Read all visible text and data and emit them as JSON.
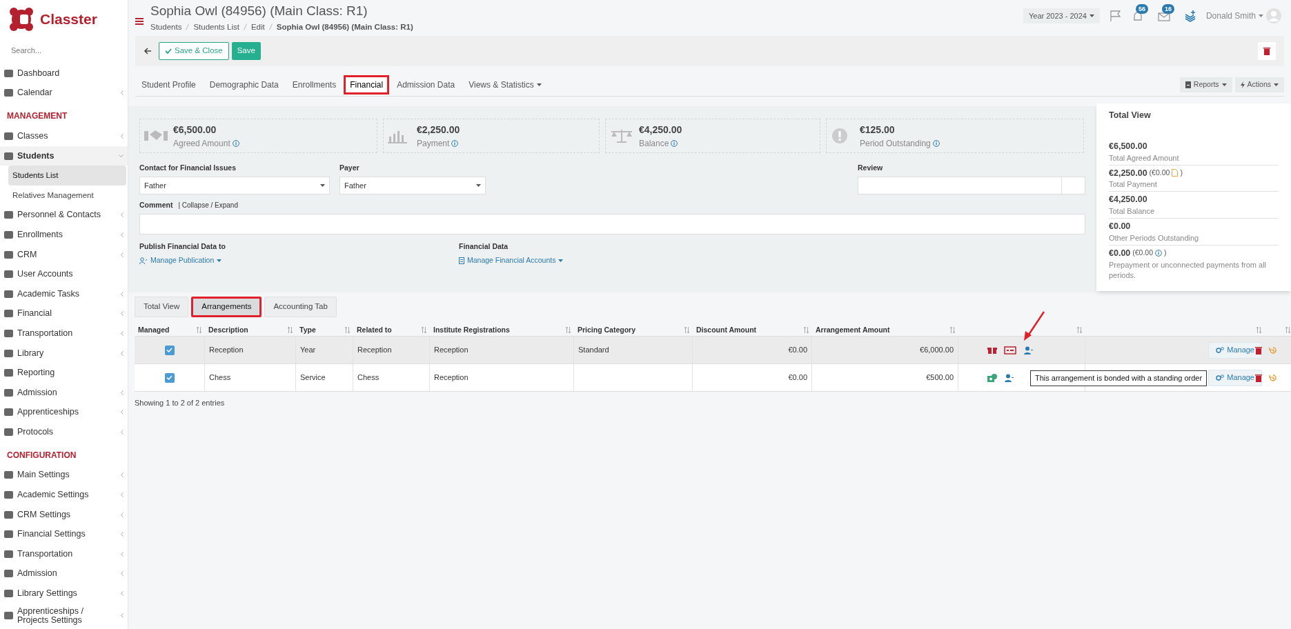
{
  "brand": {
    "name": "Classter"
  },
  "sidebar": {
    "search_placeholder": "Search...",
    "sections": [
      {
        "items": [
          {
            "label": "Dashboard",
            "submenu": false
          },
          {
            "label": "Calendar",
            "submenu": true,
            "expanded": false
          }
        ]
      },
      {
        "heading": "MANAGEMENT",
        "items": [
          {
            "label": "Classes",
            "submenu": true,
            "expanded": false
          },
          {
            "label": "Students",
            "submenu": true,
            "expanded": true,
            "children": [
              {
                "label": "Students List",
                "selected": true
              },
              {
                "label": "Relatives Management",
                "selected": false
              }
            ]
          },
          {
            "label": "Personnel & Contacts",
            "submenu": true,
            "expanded": false
          },
          {
            "label": "Enrollments",
            "submenu": true,
            "expanded": false
          },
          {
            "label": "CRM",
            "submenu": true,
            "expanded": false
          },
          {
            "label": "User Accounts",
            "submenu": false
          },
          {
            "label": "Academic Tasks",
            "submenu": true,
            "expanded": false
          },
          {
            "label": "Financial",
            "submenu": true,
            "expanded": false
          },
          {
            "label": "Transportation",
            "submenu": true,
            "expanded": false
          },
          {
            "label": "Library",
            "submenu": true,
            "expanded": false
          },
          {
            "label": "Reporting",
            "submenu": false
          },
          {
            "label": "Admission",
            "submenu": true,
            "expanded": false
          },
          {
            "label": "Apprenticeships",
            "submenu": true,
            "expanded": false
          },
          {
            "label": "Protocols",
            "submenu": true,
            "expanded": false
          }
        ]
      },
      {
        "heading": "CONFIGURATION",
        "items": [
          {
            "label": "Main Settings",
            "submenu": true,
            "expanded": false
          },
          {
            "label": "Academic Settings",
            "submenu": true,
            "expanded": false
          },
          {
            "label": "CRM Settings",
            "submenu": true,
            "expanded": false
          },
          {
            "label": "Financial Settings",
            "submenu": true,
            "expanded": false
          },
          {
            "label": "Transportation",
            "submenu": true,
            "expanded": false
          },
          {
            "label": "Admission",
            "submenu": true,
            "expanded": false
          },
          {
            "label": "Library Settings",
            "submenu": true,
            "expanded": false
          },
          {
            "label": "Apprenticeships / Projects Settings",
            "submenu": true,
            "expanded": false
          }
        ]
      }
    ]
  },
  "header": {
    "title": "Sophia Owl (84956) (Main Class: R1)",
    "breadcrumbs": [
      "Students",
      "Students List",
      "Edit",
      "Sophia Owl (84956) (Main Class: R1)"
    ],
    "year": "Year 2023 - 2024",
    "notifications": "56",
    "messages": "16",
    "user": "Donald Smith"
  },
  "toolbar": {
    "save_close": "Save & Close",
    "save": "Save"
  },
  "tabs": [
    {
      "label": "Student Profile",
      "selected": false,
      "highlighted": false
    },
    {
      "label": "Demographic Data",
      "selected": false,
      "highlighted": false
    },
    {
      "label": "Enrollments",
      "selected": false,
      "highlighted": false
    },
    {
      "label": "Financial",
      "selected": true,
      "highlighted": true
    },
    {
      "label": "Admission Data",
      "selected": false,
      "highlighted": false
    },
    {
      "label": "Views & Statistics",
      "selected": false,
      "highlighted": false,
      "dropdown": true
    }
  ],
  "tab_actions": [
    "Reports",
    "Actions"
  ],
  "stats": [
    {
      "amount": "€6,500.00",
      "label": "Agreed Amount"
    },
    {
      "amount": "€2,250.00",
      "label": "Payment"
    },
    {
      "amount": "€4,250.00",
      "label": "Balance"
    },
    {
      "amount": "€125.00",
      "label": "Period Outstanding"
    }
  ],
  "form": {
    "contact_label": "Contact for Financial Issues",
    "contact_value": "Father",
    "payer_label": "Payer",
    "payer_value": "Father",
    "review_label": "Review",
    "comment_label": "Comment",
    "comment_toggle": "| Collapse / Expand",
    "publish_label": "Publish Financial Data to",
    "publish_link": "Manage Publication",
    "financial_label": "Financial Data",
    "financial_link": "Manage Financial Accounts"
  },
  "total_view": {
    "title": "Total View",
    "entries": [
      {
        "amount": "€6,500.00",
        "label": "Total Agreed Amount"
      },
      {
        "amount": "€2,250.00",
        "note": {
          "kind": "document",
          "text": "(€0.00",
          "closing": ")"
        },
        "label": "Total Payment"
      },
      {
        "amount": "€4,250.00",
        "label": "Total Balance"
      },
      {
        "amount": "€0.00",
        "label": "Other Periods Outstanding"
      },
      {
        "amount": "€0.00",
        "note": {
          "kind": "info",
          "text": "(€0.00",
          "closing": ")"
        },
        "label": "Prepayment or unconnected payments from all periods."
      }
    ]
  },
  "sub_tabs": [
    {
      "label": "Total View",
      "selected": false,
      "highlighted": false
    },
    {
      "label": "Arrangements",
      "selected": true,
      "highlighted": true
    },
    {
      "label": "Accounting Tab",
      "selected": false,
      "highlighted": false
    }
  ],
  "table": {
    "columns": [
      "Managed",
      "Description",
      "Type",
      "Related to",
      "Institute Registrations",
      "Pricing Category",
      "Discount Amount",
      "Arrangement Amount"
    ],
    "rows": [
      {
        "managed": true,
        "selected": true,
        "description": "Reception",
        "type": "Year",
        "related_to": "Reception",
        "institute_registrations": "Reception",
        "pricing_category": "Standard",
        "discount_amount": "€0.00",
        "arrangement_amount": "€6,000.00",
        "icons": [
          {
            "kind": "gift"
          },
          {
            "kind": "standing-order"
          },
          {
            "kind": "person"
          }
        ],
        "manage": "Manage"
      },
      {
        "managed": true,
        "selected": false,
        "description": "Chess",
        "type": "Service",
        "related_to": "Chess",
        "institute_registrations": "Reception",
        "discount_amount": "€0.00",
        "arrangement_amount": "€500.00",
        "icons": [
          {
            "kind": "money"
          },
          {
            "kind": "person"
          }
        ],
        "manage": "Manage"
      }
    ],
    "footer": "Showing 1 to 2 of 2 entries"
  },
  "tooltip": "This arrangement is bonded with a standing order"
}
